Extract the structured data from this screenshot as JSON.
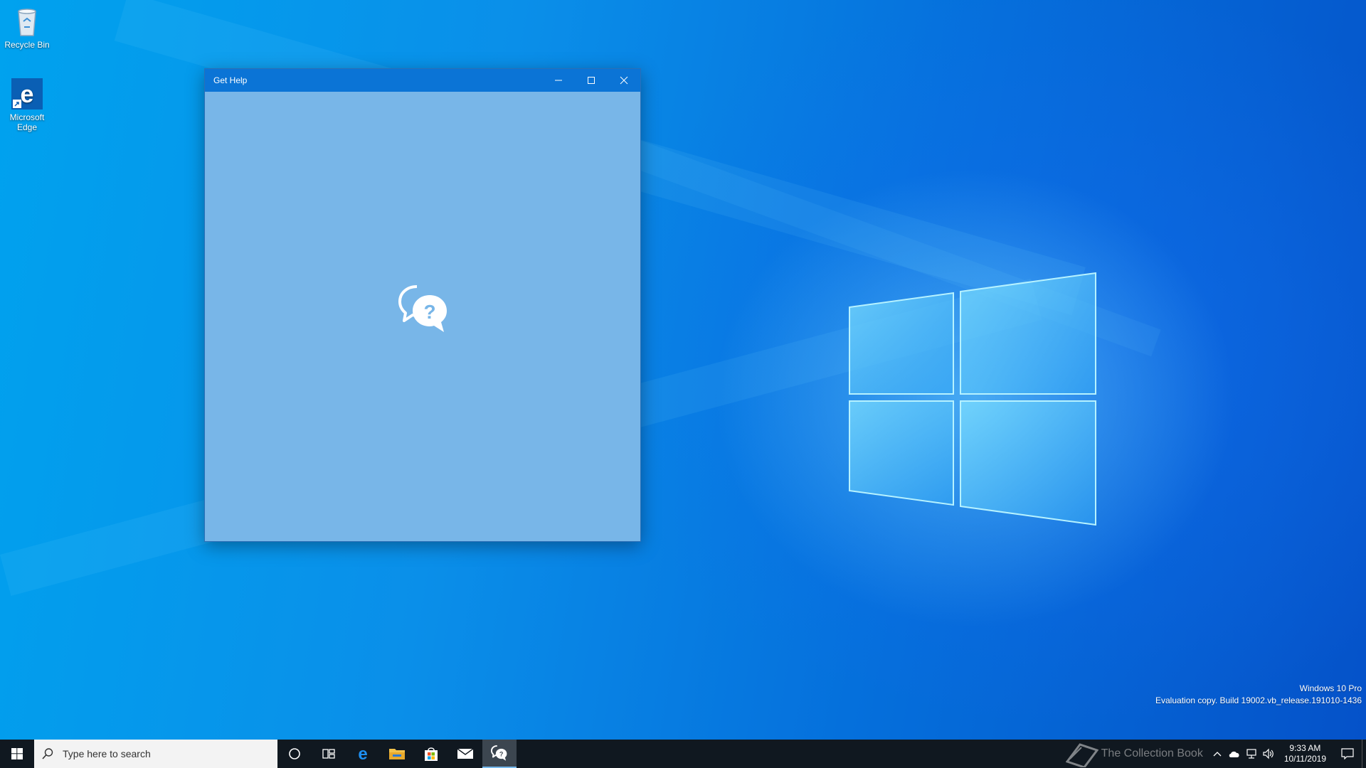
{
  "desktop": {
    "icons": [
      {
        "label": "Recycle Bin",
        "icon": "recycle-bin-icon"
      },
      {
        "label": "Microsoft Edge",
        "icon": "edge-icon"
      }
    ],
    "watermark": {
      "line1": "Windows 10 Pro",
      "line2": "Evaluation copy. Build 19002.vb_release.191010-1436"
    },
    "overlay_logo_text": "The Collection Book"
  },
  "window": {
    "title": "Get Help",
    "splash_icon": "get-help-icon",
    "controls": {
      "minimize": "minimize-icon",
      "maximize": "maximize-icon",
      "close": "close-icon"
    },
    "colors": {
      "titlebar": "#0b74d6",
      "body": "#78b6e8"
    }
  },
  "taskbar": {
    "search_placeholder": "Type here to search",
    "apps": [
      {
        "name": "cortana",
        "icon": "cortana-circle-icon"
      },
      {
        "name": "task-view",
        "icon": "task-view-icon"
      },
      {
        "name": "edge",
        "icon": "edge-icon"
      },
      {
        "name": "file-explorer",
        "icon": "folder-icon"
      },
      {
        "name": "store",
        "icon": "store-bag-icon"
      },
      {
        "name": "mail",
        "icon": "mail-icon"
      },
      {
        "name": "get-help",
        "icon": "get-help-icon",
        "active": true
      }
    ],
    "clock": {
      "time": "9:33 AM",
      "date": "10/11/2019"
    },
    "tray_icons": [
      "chevron-up-icon",
      "onedrive-icon",
      "network-icon",
      "volume-icon"
    ]
  }
}
